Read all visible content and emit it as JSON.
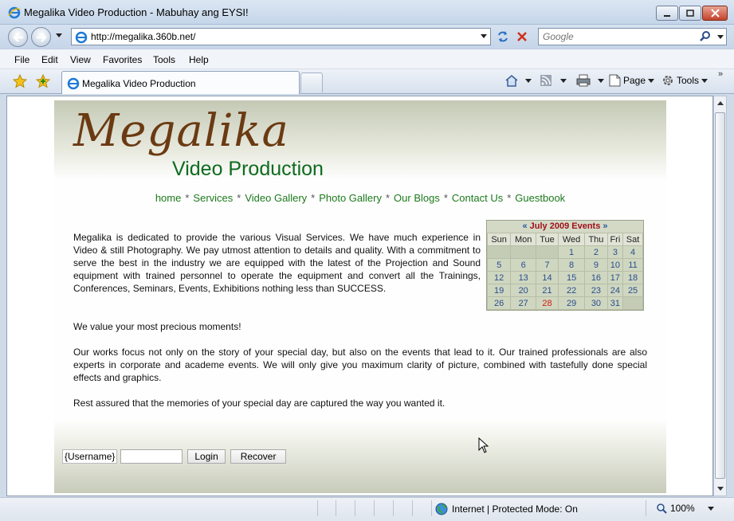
{
  "window": {
    "title": "Megalika Video Production - Mabuhay ang EYSI!"
  },
  "navbar": {
    "address": "http://megalika.360b.net/",
    "search_placeholder": "Google"
  },
  "menu": [
    "File",
    "Edit",
    "View",
    "Favorites",
    "Tools",
    "Help"
  ],
  "tab": {
    "label": "Megalika Video Production"
  },
  "toolbar": {
    "page_label": "Page",
    "tools_label": "Tools"
  },
  "site": {
    "logo_script": "Megalika",
    "logo_sub": "Video Production",
    "nav": [
      "home",
      "Services",
      "Video Gallery",
      "Photo Gallery",
      "Our Blogs",
      "Contact Us",
      "Guestbook"
    ],
    "nav_separator": "*",
    "intro": "Megalika is dedicated to provide the various Visual Services. We have much experience in Video & still Photography. We pay utmost attention to details and quality. With a commitment to serve the best in the industry we are equipped with the latest of the Projection and Sound equipment with trained personnel to operate the equipment and convert all the Trainings, Conferences, Seminars, Events, Exhibitions nothing less than SUCCESS.",
    "value_line": "We value your most precious moments!",
    "works": "Our works focus not only on the story of your special day, but also on the events that lead to it. Our trained professionals are also experts in corporate and academe events. We will only give you maximum clarity of picture, combined with tastefully done special effects and graphics.",
    "rest": "Rest assured that the memories of your special day are captured the way you wanted it."
  },
  "calendar": {
    "prev": "«",
    "next": "»",
    "title": "July 2009 Events",
    "days": [
      "Sun",
      "Mon",
      "Tue",
      "Wed",
      "Thu",
      "Fri",
      "Sat"
    ],
    "weeks": [
      [
        "",
        "",
        "",
        "1",
        "2",
        "3",
        "4"
      ],
      [
        "5",
        "6",
        "7",
        "8",
        "9",
        "10",
        "11"
      ],
      [
        "12",
        "13",
        "14",
        "15",
        "16",
        "17",
        "18"
      ],
      [
        "19",
        "20",
        "21",
        "22",
        "23",
        "24",
        "25"
      ],
      [
        "26",
        "27",
        "28",
        "29",
        "30",
        "31",
        ""
      ]
    ],
    "highlight": "28",
    "highlight_color": "#d21a10"
  },
  "login": {
    "username_label": "{Username}",
    "login_button": "Login",
    "recover_button": "Recover"
  },
  "status": {
    "zone": "Internet | Protected Mode: On",
    "zoom": "100%"
  },
  "colors": {
    "nav_link": "#1c7a1c",
    "logo_brown": "#6b3a12",
    "logo_green": "#0d6b1f"
  }
}
